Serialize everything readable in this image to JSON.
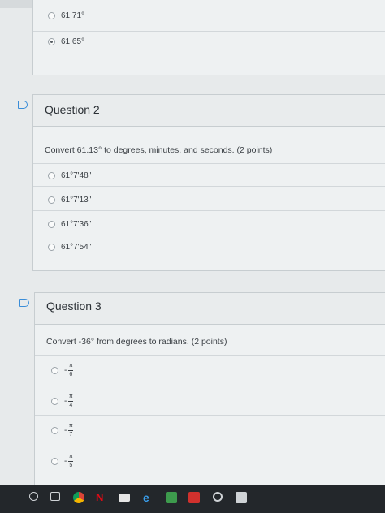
{
  "prev_question": {
    "options": [
      {
        "text": "61.71°",
        "checked": false
      },
      {
        "text": "61.65°",
        "checked": true
      }
    ]
  },
  "question2": {
    "title": "Question 2",
    "prompt": "Convert 61.13° to degrees, minutes, and seconds. (2 points)",
    "options": [
      {
        "text": "61°7'48\""
      },
      {
        "text": "61°7'13\""
      },
      {
        "text": "61°7'36\""
      },
      {
        "text": "61°7'54\""
      }
    ]
  },
  "question3": {
    "title": "Question 3",
    "prompt": "Convert -36° from degrees to radians. (2 points)",
    "options": [
      {
        "sign": "-",
        "numerator": "π",
        "denominator": "6"
      },
      {
        "sign": "-",
        "numerator": "π",
        "denominator": "4"
      },
      {
        "sign": "-",
        "numerator": "π",
        "denominator": "7"
      },
      {
        "sign": "-",
        "numerator": "π",
        "denominator": "5"
      }
    ]
  },
  "colors": {
    "flag": "#3a8dd8",
    "taskbar": "#23272b"
  },
  "taskbar_icons": [
    "search-icon",
    "task-view-icon",
    "chrome-icon",
    "netflix-icon",
    "mail-icon",
    "edge-icon",
    "photos-icon",
    "acrobat-icon",
    "settings-icon",
    "image-icon"
  ]
}
